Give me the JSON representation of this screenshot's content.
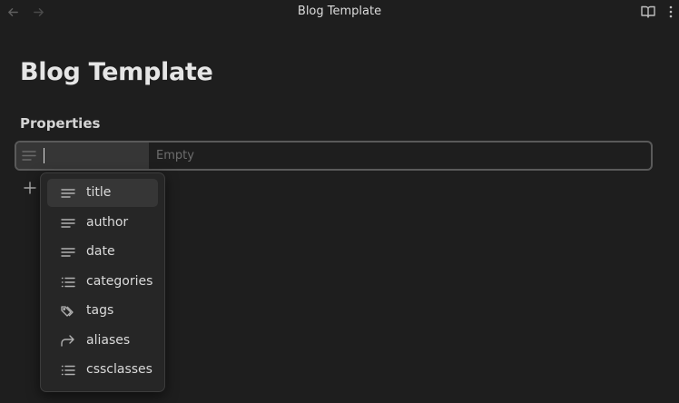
{
  "window": {
    "tab_title": "Blog Template",
    "nav_back_icon": "arrow-left-icon",
    "nav_forward_icon": "arrow-right-icon",
    "reading_mode_icon": "book-open-icon",
    "more_options_icon": "more-vertical-icon"
  },
  "note": {
    "title": "Blog Template",
    "properties_heading": "Properties"
  },
  "property_row": {
    "key_value": "",
    "value_placeholder": "Empty",
    "type_icon": "text-lines-icon"
  },
  "add_property_icon": "plus-icon",
  "suggestions": [
    {
      "label": "title",
      "icon": "text-lines-icon",
      "selected": true
    },
    {
      "label": "author",
      "icon": "text-lines-icon",
      "selected": false
    },
    {
      "label": "date",
      "icon": "text-lines-icon",
      "selected": false
    },
    {
      "label": "categories",
      "icon": "list-icon",
      "selected": false
    },
    {
      "label": "tags",
      "icon": "tags-icon",
      "selected": false
    },
    {
      "label": "aliases",
      "icon": "forward-arrow-icon",
      "selected": false
    },
    {
      "label": "cssclasses",
      "icon": "list-icon",
      "selected": false
    }
  ],
  "colors": {
    "background": "#1e1e1e",
    "menu_background": "#262626",
    "selected_item": "#363636",
    "text": "#dadada",
    "muted_text": "#6d6d6d"
  }
}
